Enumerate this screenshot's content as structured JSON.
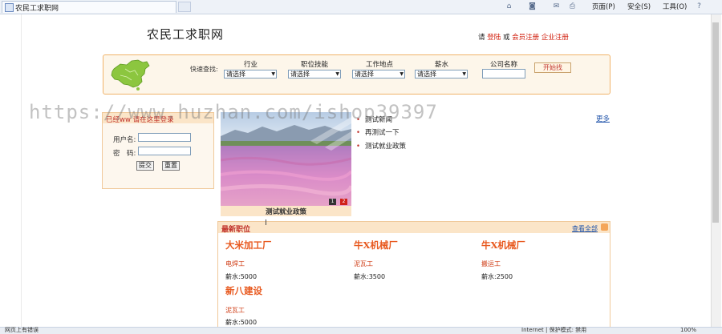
{
  "browser": {
    "tab_title": "农民工求职网",
    "menus": {
      "page": "页面(P)",
      "safety": "安全(S)",
      "tools": "工具(O)"
    },
    "status_left": "网页上有错误",
    "status_zone": "Internet | 保护模式: 禁用",
    "zoom": "100%"
  },
  "header": {
    "site_title": "农民工求职网",
    "please": "请",
    "login": "登陆",
    "or": "或",
    "member_register": "会员注册",
    "company_register": "企业注册"
  },
  "search": {
    "quick_label": "快速查找:",
    "fields": [
      {
        "label": "行业",
        "value": "请选择"
      },
      {
        "label": "职位技能",
        "value": "请选择"
      },
      {
        "label": "工作地点",
        "value": "请选择"
      },
      {
        "label": "薪水",
        "value": "请选择"
      }
    ],
    "company_label": "公司名称",
    "company_value": "",
    "button": "开始找"
  },
  "login_box": {
    "heading": "已经ww 请在这里登录",
    "username_label": "用户名:",
    "password_label": "密　码:",
    "submit": "提交",
    "reset": "重置"
  },
  "news": {
    "items": [
      "测试新闻",
      "再测试一下",
      "测试就业政策"
    ],
    "more": "更多",
    "photo_caption": "测试就业政策",
    "photo_pages": [
      "1",
      "2"
    ]
  },
  "jobs": {
    "title": "最新职位",
    "view_all": "查看全部",
    "listings": [
      {
        "company": "大米加工厂",
        "position": "电焊工",
        "salary": "薪水:5000"
      },
      {
        "company": "牛X机械厂",
        "position": "泥瓦工",
        "salary": "薪水:3500"
      },
      {
        "company": "牛X机械厂",
        "position": "搬运工",
        "salary": "薪水:2500"
      },
      {
        "company": "新八建设",
        "position": "泥瓦工",
        "salary": "薪水:5000"
      }
    ]
  },
  "watermark": "https://www.huzhan.com/ishop39397",
  "colors": {
    "accent_red": "#c0322b",
    "company_orange": "#e85a20",
    "panel_border": "#f0b36a",
    "panel_bg": "#fdf6ea"
  },
  "icons": [
    "home-icon",
    "feed-icon",
    "mail-icon",
    "print-icon",
    "help-icon",
    "china-map-icon"
  ]
}
